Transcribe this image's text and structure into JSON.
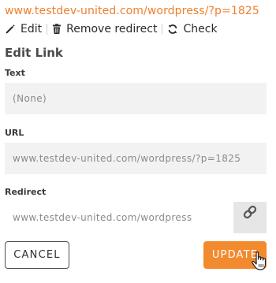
{
  "link_header": {
    "url": "www.testdev-united.com/wordpress/?p=1825"
  },
  "actions": {
    "edit_label": "Edit",
    "remove_redirect_label": "Remove redirect",
    "check_label": "Check"
  },
  "form": {
    "title": "Edit Link",
    "text_label": "Text",
    "text_value": "(None)",
    "url_label": "URL",
    "url_value": "www.testdev-united.com/wordpress/?p=1825",
    "redirect_label": "Redirect",
    "redirect_value": "www.testdev-united.com/wordpress"
  },
  "buttons": {
    "cancel_label": "CANCEL",
    "update_label": "UPDATE"
  },
  "icons": {
    "edit": "pencil-icon",
    "remove_redirect": "trash-icon",
    "check": "refresh-icon",
    "redirect_link": "link-icon",
    "cursor": "hand-pointer-icon"
  },
  "colors": {
    "accent": "#f28a2e",
    "url_text": "#f07f2b",
    "field_bg": "#f2f2f2"
  }
}
